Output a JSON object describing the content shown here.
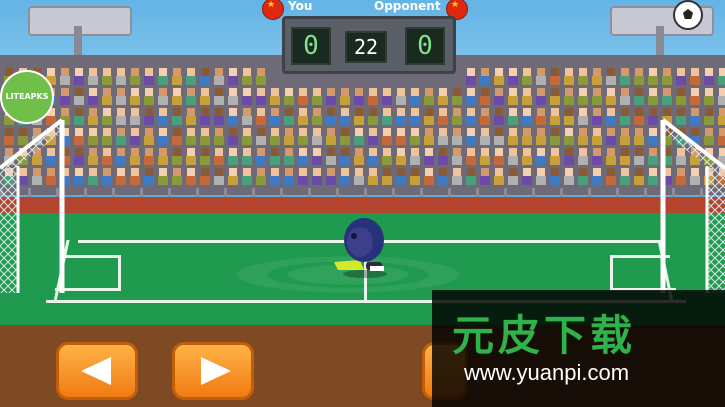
{
  "scoreboard": {
    "player_name": "You",
    "opponent_name": "Opponent",
    "player_score": "0",
    "opponent_score": "0",
    "timer": "22"
  },
  "watermark": {
    "corner_label": "LITEAPKS",
    "brand": "元皮下载",
    "url": "www.yuanpi.com"
  },
  "colors": {
    "pitch": "#1f9a4e",
    "track": "#b3452f",
    "button": "#f07b12",
    "flag": "#de2910"
  },
  "icons": {
    "settings": "soccer-ball-icon",
    "left": "arrow-left-icon",
    "right": "arrow-right-icon"
  }
}
